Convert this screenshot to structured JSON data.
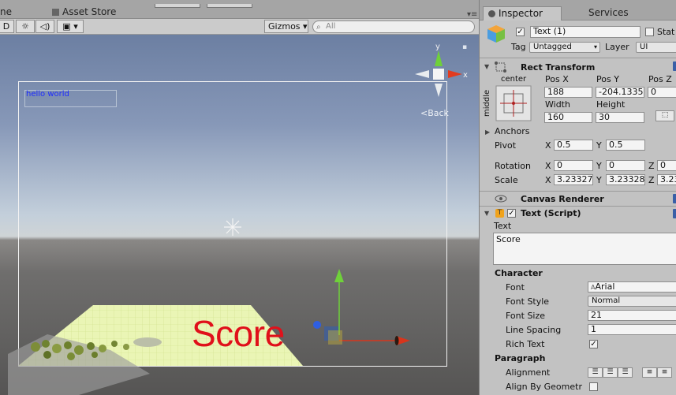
{
  "scene": {
    "tab_scene_clip": "ne",
    "tab_asset_store": "Asset Store",
    "toolbar": {
      "mode_2d": "D",
      "light_icon": "sun-icon",
      "audio_icon": "speaker-icon",
      "fx_icon": "image-icon",
      "fx_arrow": "▾",
      "gizmos": "Gizmos",
      "gizmos_arrow": "▾",
      "search_placeholder": "All"
    },
    "hello_text": "hello world",
    "back_label": "Back",
    "score_text": "Score",
    "gizmo_axes": {
      "y": "y",
      "x": "x"
    }
  },
  "inspector": {
    "tab_inspector": "Inspector",
    "tab_services": "Services",
    "object": {
      "name": "Text (1)",
      "active": true,
      "static_label": "Stat",
      "tag_label": "Tag",
      "tag_value": "Untagged",
      "layer_label": "Layer",
      "layer_value": "UI"
    },
    "rect_transform": {
      "title": "Rect Transform",
      "anchor_h": "center",
      "anchor_v": "middle",
      "pos_x_label": "Pos X",
      "pos_y_label": "Pos Y",
      "pos_z_label": "Pos Z",
      "pos_x": "188",
      "pos_y": "-204.1335",
      "pos_z": "0",
      "width_label": "Width",
      "height_label": "Height",
      "width": "160",
      "height": "30",
      "anchors_label": "Anchors",
      "pivot_label": "Pivot",
      "pivot_x": "0.5",
      "pivot_y": "0.5",
      "rotation_label": "Rotation",
      "rot_x": "0",
      "rot_y": "0",
      "rot_z": "0",
      "scale_label": "Scale",
      "scale_x": "3.23327",
      "scale_y": "3.23328",
      "scale_z": "3.23",
      "axis_x": "X",
      "axis_y": "Y",
      "axis_z": "Z"
    },
    "canvas_renderer": {
      "title": "Canvas Renderer"
    },
    "text_script": {
      "title": "Text (Script)",
      "enabled": true,
      "text_label": "Text",
      "text_value": "Score",
      "character_header": "Character",
      "font_label": "Font",
      "font_value": "Arial",
      "font_style_label": "Font Style",
      "font_style_value": "Normal",
      "font_size_label": "Font Size",
      "font_size_value": "21",
      "line_spacing_label": "Line Spacing",
      "line_spacing_value": "1",
      "rich_text_label": "Rich Text",
      "rich_text": true,
      "paragraph_header": "Paragraph",
      "alignment_label": "Alignment",
      "align_by_geometry_label": "Align By Geometr",
      "align_by_geometry": false
    }
  }
}
